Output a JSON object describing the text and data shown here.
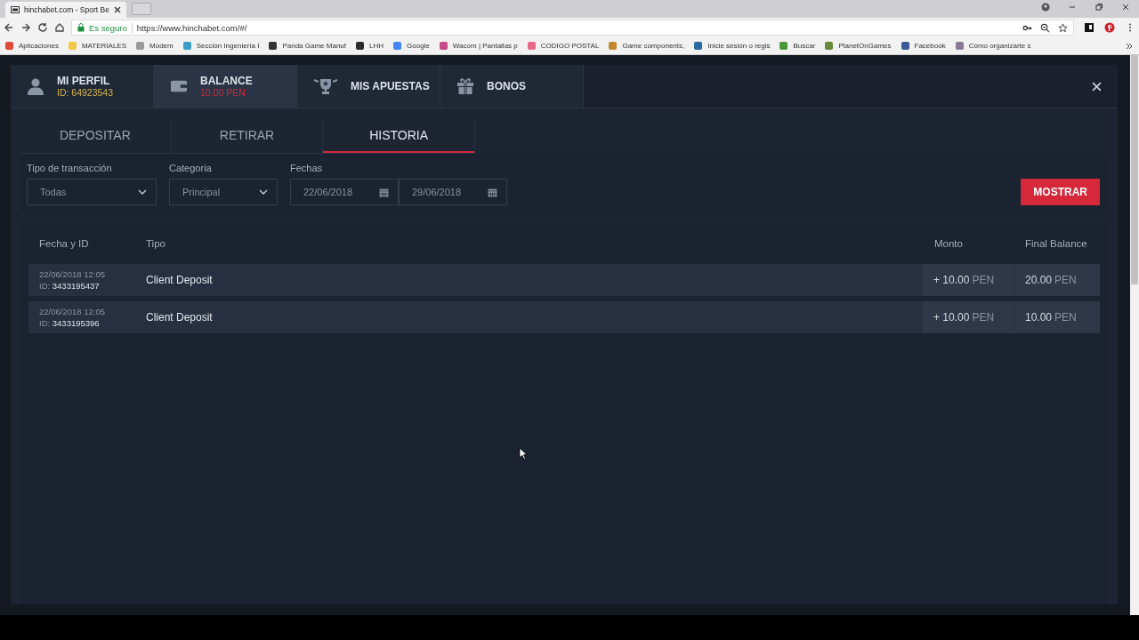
{
  "browser": {
    "tab_title": "hinchabet.com - Sport Be",
    "secure_label": "Es seguro",
    "url": "https://www.hinchabet.com/#/",
    "bookmarks": [
      {
        "label": "Aplicaciones",
        "color": "#e04a3a"
      },
      {
        "label": "MATERIALES",
        "color": "#f2c744"
      },
      {
        "label": "Modem",
        "color": "#9a9a9a"
      },
      {
        "label": "Sección Ingeniería I",
        "color": "#3aa0c8"
      },
      {
        "label": "Panda Game Manuf",
        "color": "#333333"
      },
      {
        "label": "LHH",
        "color": "#2b2b2b"
      },
      {
        "label": "Google",
        "color": "#4285f4"
      },
      {
        "label": "Wacom | Pantallas p",
        "color": "#c84a8a"
      },
      {
        "label": "CODIGO POSTAL",
        "color": "#e86a8a"
      },
      {
        "label": "Game components,",
        "color": "#c08a30"
      },
      {
        "label": "Inicie sesión o regis",
        "color": "#2a6aa0"
      },
      {
        "label": "Buscar",
        "color": "#4a9a3a"
      },
      {
        "label": "PlanetOnGames",
        "color": "#6a8a3a"
      },
      {
        "label": "Facebook",
        "color": "#3b5998"
      },
      {
        "label": "Cómo organizarte s",
        "color": "#8a7a9a"
      }
    ]
  },
  "header_tabs": [
    {
      "kind": "profile",
      "label": "MI PERFIL",
      "sub": "ID: 64923543",
      "selected": false
    },
    {
      "kind": "balance",
      "label": "BALANCE",
      "sub": "10.00 PEN",
      "selected": true
    },
    {
      "kind": "bets",
      "label": "MIS APUESTAS",
      "selected": false
    },
    {
      "kind": "bonus",
      "label": "BONOS",
      "selected": false
    }
  ],
  "sub_tabs": [
    {
      "label": "DEPOSITAR",
      "selected": false
    },
    {
      "label": "RETIRAR",
      "selected": false
    },
    {
      "label": "HISTORIA",
      "selected": true
    }
  ],
  "filters": {
    "type": {
      "label": "Tipo de transacción",
      "value": "Todas"
    },
    "category": {
      "label": "Categoria",
      "value": "Principal"
    },
    "dates": {
      "label": "Fechas",
      "from": "22/06/2018",
      "to": "29/06/2018"
    }
  },
  "show_button": "MOSTRAR",
  "table": {
    "columns": [
      "Fecha y ID",
      "Tipo",
      "Monto",
      "Final Balance"
    ],
    "rows": [
      {
        "date": "22/06/2018 12:05",
        "id_label": "ID:",
        "id": "3433195437",
        "type": "Client Deposit",
        "amount": "+ 10.00",
        "amount_currency": "PEN",
        "balance": "20.00",
        "balance_currency": "PEN"
      },
      {
        "date": "22/06/2018 12:05",
        "id_label": "ID:",
        "id": "3433195396",
        "type": "Client Deposit",
        "amount": "+ 10.00",
        "amount_currency": "PEN",
        "balance": "10.00",
        "balance_currency": "PEN"
      }
    ]
  }
}
